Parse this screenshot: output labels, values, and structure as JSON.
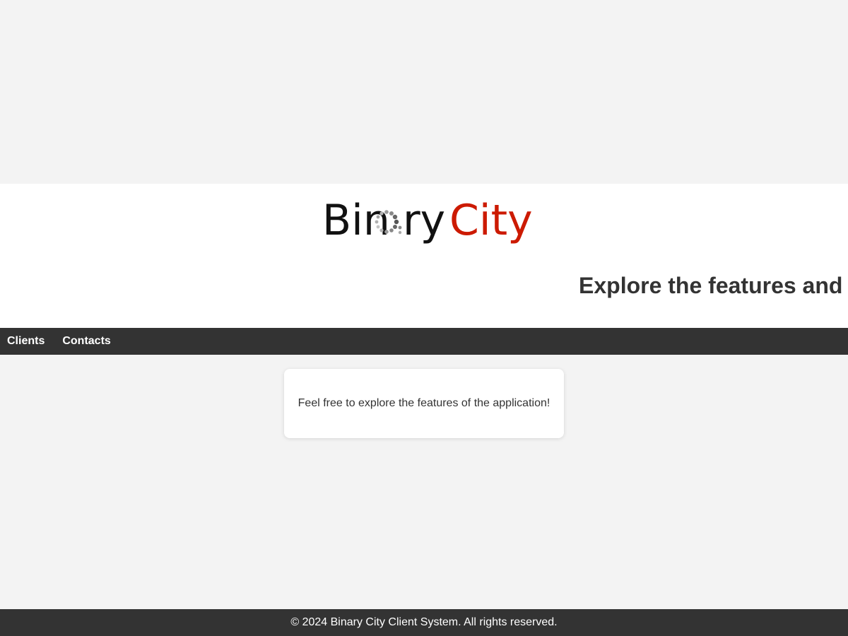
{
  "header": {
    "logo": {
      "word1": "Bin",
      "word1_end": "ry",
      "word2": "City",
      "colors": {
        "dark": "#111111",
        "accent": "#cc1a00",
        "dots_dark": "#555555",
        "dots_light": "#b5b5b5"
      }
    },
    "marquee_text": "Explore the features and"
  },
  "nav": {
    "items": [
      {
        "label": "Clients"
      },
      {
        "label": "Contacts"
      }
    ]
  },
  "main": {
    "card_text": "Feel free to explore the features of the application!"
  },
  "footer": {
    "text": "© 2024 Binary City Client System. All rights reserved."
  },
  "colors": {
    "page_bg": "#f3f3f3",
    "header_bg": "#ffffff",
    "nav_bg": "#333333",
    "text": "#333333"
  }
}
